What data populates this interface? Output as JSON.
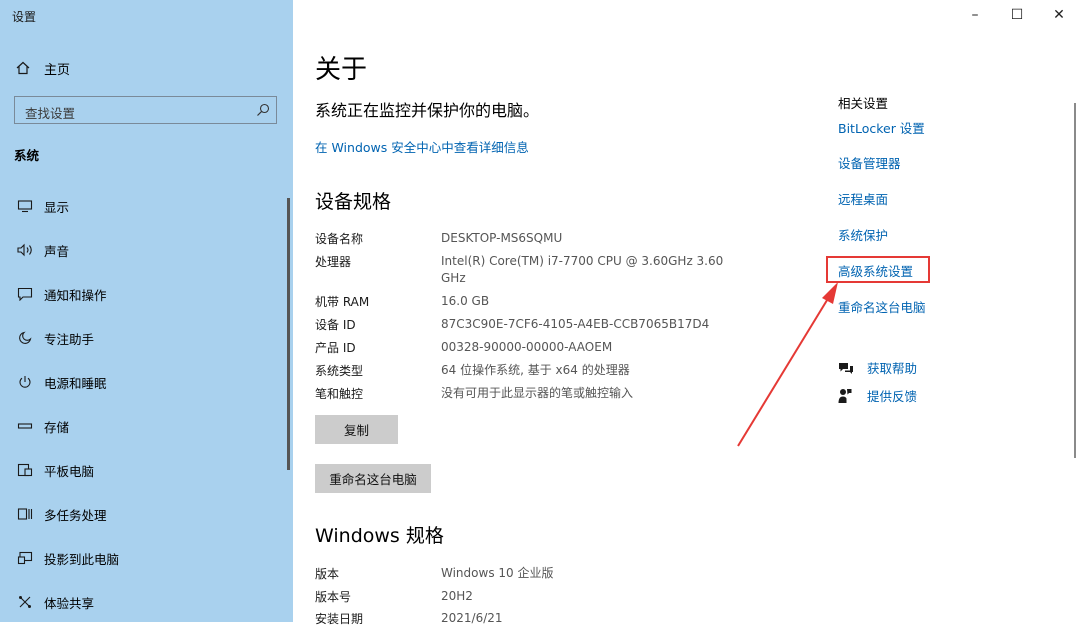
{
  "app": {
    "title": "设置"
  },
  "window_controls": {
    "minimize": "–",
    "maximize": "☐",
    "close": "✕"
  },
  "sidebar": {
    "home_label": "主页",
    "search_placeholder": "查找设置",
    "section_label": "系统",
    "items": [
      {
        "label": "显示",
        "icon": "monitor-icon"
      },
      {
        "label": "声音",
        "icon": "speaker-icon"
      },
      {
        "label": "通知和操作",
        "icon": "notification-icon"
      },
      {
        "label": "专注助手",
        "icon": "moon-icon"
      },
      {
        "label": "电源和睡眠",
        "icon": "power-icon"
      },
      {
        "label": "存储",
        "icon": "storage-icon"
      },
      {
        "label": "平板电脑",
        "icon": "tablet-icon"
      },
      {
        "label": "多任务处理",
        "icon": "multitask-icon"
      },
      {
        "label": "投影到此电脑",
        "icon": "projector-icon"
      },
      {
        "label": "体验共享",
        "icon": "share-icon"
      }
    ]
  },
  "main": {
    "title": "关于",
    "status": "系统正在监控并保护你的电脑。",
    "security_link": "在 Windows 安全中心中查看详细信息",
    "device_specs_heading": "设备规格",
    "device_specs": [
      {
        "label": "设备名称",
        "value": "DESKTOP-MS6SQMU"
      },
      {
        "label": "处理器",
        "value": "Intel(R) Core(TM) i7-7700 CPU @ 3.60GHz   3.60 GHz"
      },
      {
        "label": "机带 RAM",
        "value": "16.0 GB"
      },
      {
        "label": "设备 ID",
        "value": "87C3C90E-7CF6-4105-A4EB-CCB7065B17D4"
      },
      {
        "label": "产品 ID",
        "value": "00328-90000-00000-AAOEM"
      },
      {
        "label": "系统类型",
        "value": "64 位操作系统, 基于 x64 的处理器"
      },
      {
        "label": "笔和触控",
        "value": "没有可用于此显示器的笔或触控输入"
      }
    ],
    "copy_button": "复制",
    "rename_button": "重命名这台电脑",
    "windows_specs_heading": "Windows 规格",
    "windows_specs": [
      {
        "label": "版本",
        "value": "Windows 10 企业版"
      },
      {
        "label": "版本号",
        "value": "20H2"
      },
      {
        "label": "安装日期",
        "value": "2021/6/21"
      }
    ]
  },
  "related": {
    "heading": "相关设置",
    "links": [
      "BitLocker 设置",
      "设备管理器",
      "远程桌面",
      "系统保护",
      "高级系统设置",
      "重命名这台电脑"
    ],
    "highlighted_link": "高级系统设置",
    "help": {
      "label": "获取帮助",
      "icon": "help-chat-icon"
    },
    "feedback": {
      "label": "提供反馈",
      "icon": "feedback-icon"
    }
  },
  "annotation": {
    "highlight_color": "#e53935"
  }
}
